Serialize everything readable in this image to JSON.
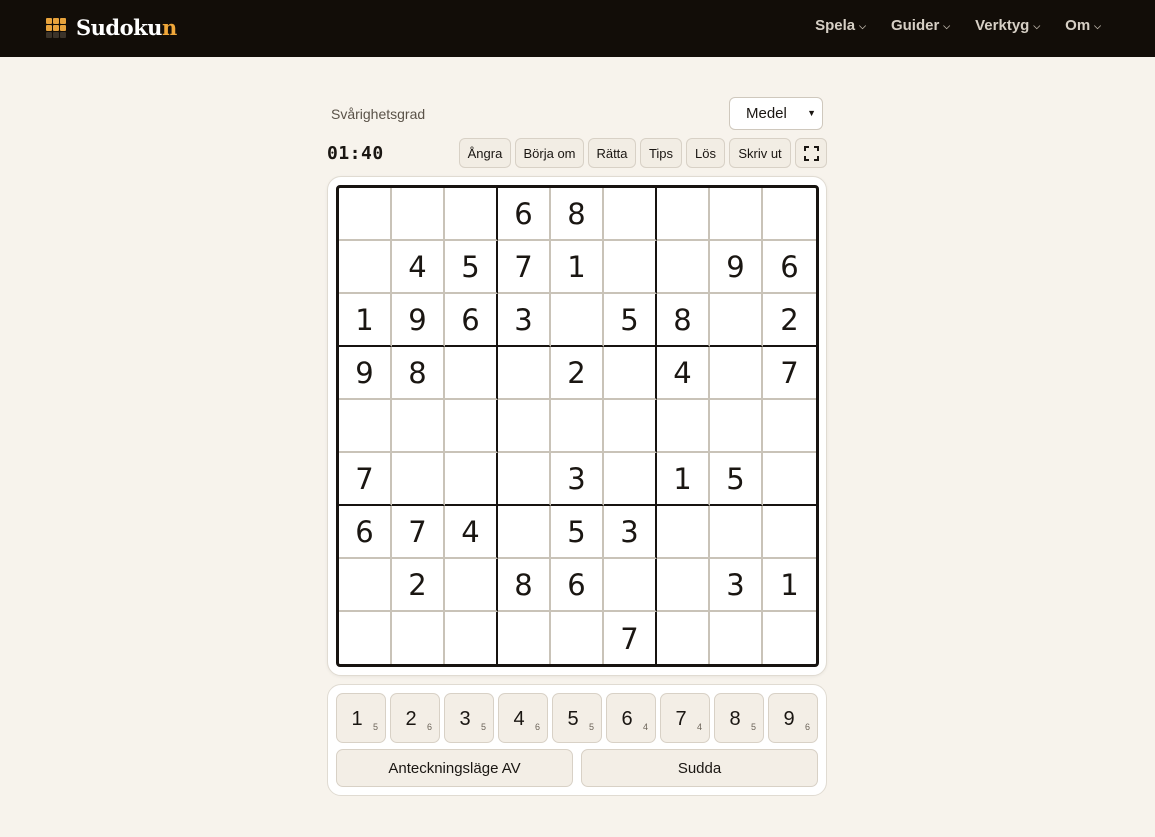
{
  "brand": {
    "name_main": "Sudoku",
    "name_accent": "n"
  },
  "nav": [
    {
      "label": "Spela"
    },
    {
      "label": "Guider"
    },
    {
      "label": "Verktyg"
    },
    {
      "label": "Om"
    }
  ],
  "difficulty": {
    "label": "Svårighetsgrad",
    "selected": "Medel"
  },
  "timer": "01:40",
  "toolbar": {
    "undo": "Ångra",
    "restart": "Börja om",
    "check": "Rätta",
    "hint": "Tips",
    "solve": "Lös",
    "print": "Skriv ut"
  },
  "grid": [
    [
      "",
      "",
      "",
      "6",
      "8",
      "",
      "",
      "",
      ""
    ],
    [
      "",
      "4",
      "5",
      "7",
      "1",
      "",
      "",
      "9",
      "6"
    ],
    [
      "1",
      "9",
      "6",
      "3",
      "",
      "5",
      "8",
      "",
      "2"
    ],
    [
      "9",
      "8",
      "",
      "",
      "2",
      "",
      "4",
      "",
      "7"
    ],
    [
      "",
      "",
      "",
      "",
      "",
      "",
      "",
      "",
      ""
    ],
    [
      "7",
      "",
      "",
      "",
      "3",
      "",
      "1",
      "5",
      ""
    ],
    [
      "6",
      "7",
      "4",
      "",
      "5",
      "3",
      "",
      "",
      ""
    ],
    [
      "",
      "2",
      "",
      "8",
      "6",
      "",
      "",
      "3",
      "1"
    ],
    [
      "",
      "",
      "",
      "",
      "",
      "7",
      "",
      "",
      ""
    ]
  ],
  "numpad": [
    {
      "digit": "1",
      "remaining": "5"
    },
    {
      "digit": "2",
      "remaining": "6"
    },
    {
      "digit": "3",
      "remaining": "5"
    },
    {
      "digit": "4",
      "remaining": "6"
    },
    {
      "digit": "5",
      "remaining": "5"
    },
    {
      "digit": "6",
      "remaining": "4"
    },
    {
      "digit": "7",
      "remaining": "4"
    },
    {
      "digit": "8",
      "remaining": "5"
    },
    {
      "digit": "9",
      "remaining": "6"
    }
  ],
  "actions": {
    "notes": "Anteckningsläge AV",
    "erase": "Sudda"
  }
}
